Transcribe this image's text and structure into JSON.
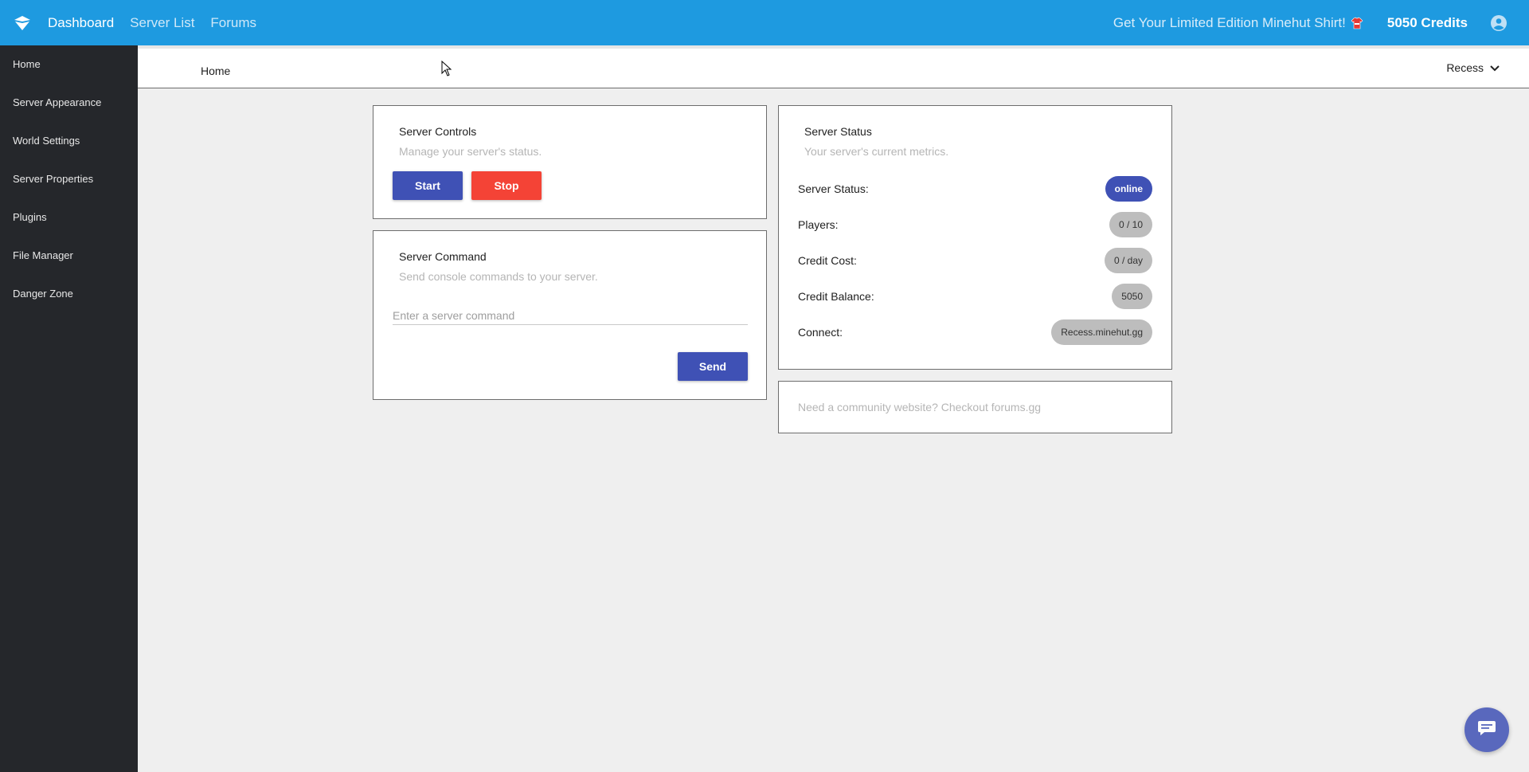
{
  "topbar": {
    "logo_icon": "minehut-logo-icon",
    "nav": [
      {
        "label": "Dashboard",
        "active": true
      },
      {
        "label": "Server List",
        "active": false
      },
      {
        "label": "Forums",
        "active": false
      }
    ],
    "promo": "Get Your Limited Edition Minehut Shirt!",
    "promo_icon": "shirt-icon",
    "credits": "5050 Credits",
    "account_icon": "account-circle-icon",
    "color": "#1e9ae0"
  },
  "sidebar": {
    "items": [
      {
        "label": "Home"
      },
      {
        "label": "Server Appearance"
      },
      {
        "label": "World Settings"
      },
      {
        "label": "Server Properties"
      },
      {
        "label": "Plugins"
      },
      {
        "label": "File Manager"
      },
      {
        "label": "Danger Zone"
      }
    ]
  },
  "subbar": {
    "breadcrumb": "Home",
    "server_name": "Recess",
    "dropdown_icon": "chevron-down-icon"
  },
  "controls": {
    "title": "Server Controls",
    "subtitle": "Manage your server's status.",
    "start_label": "Start",
    "stop_label": "Stop"
  },
  "command": {
    "title": "Server Command",
    "subtitle": "Send console commands to your server.",
    "placeholder": "Enter a server command",
    "send_label": "Send"
  },
  "status": {
    "title": "Server Status",
    "subtitle": "Your server's current metrics.",
    "rows": [
      {
        "label": "Server Status:",
        "value": "online"
      },
      {
        "label": "Players:",
        "value": "0 / 10"
      },
      {
        "label": "Credit Cost:",
        "value": "0 / day"
      },
      {
        "label": "Credit Balance:",
        "value": "5050"
      },
      {
        "label": "Connect:",
        "value": "Recess.minehut.gg"
      }
    ]
  },
  "promo_card": {
    "text": "Need a community website? Checkout forums.gg"
  },
  "chat": {
    "icon": "chat-bubble-icon"
  },
  "colors": {
    "primary": "#3f51b5",
    "danger": "#f44336",
    "sidebar": "#25272b"
  }
}
